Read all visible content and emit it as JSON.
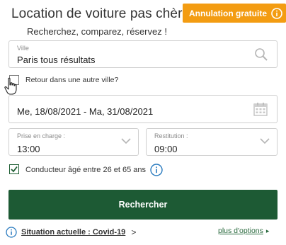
{
  "header": {
    "title": "Location de voiture pas chère",
    "badge": "Annulation gratuite",
    "subtitle": "Recherchez, comparez, réservez !"
  },
  "city": {
    "label": "Ville",
    "value": "Paris tous résultats",
    "icon": "search-icon"
  },
  "return_other_city": {
    "label": "Retour dans une autre ville?",
    "checked": false
  },
  "dates": {
    "value": "Me, 18/08/2021 - Ma, 31/08/2021",
    "icon": "calendar-icon"
  },
  "pickup": {
    "label": "Prise en charge :",
    "value": "13:00"
  },
  "dropoff": {
    "label": "Restitution :",
    "value": "09:00"
  },
  "driver_age": {
    "label": "Conducteur âgé entre 26 et 65 ans",
    "checked": true
  },
  "search_button": "Rechercher",
  "footer": {
    "covid_link": "Situation actuelle : Covid-19",
    "covid_chevron": ">",
    "more_options": "plus d'options",
    "more_chevron": "▸"
  },
  "colors": {
    "accent_orange": "#f39c12",
    "primary_green": "#1d5a34",
    "link_green": "#2a6a3e",
    "info_blue": "#2a7bbf"
  }
}
